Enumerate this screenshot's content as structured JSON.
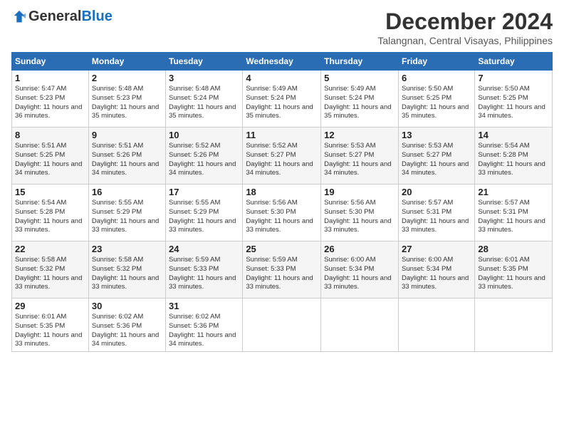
{
  "header": {
    "logo_general": "General",
    "logo_blue": "Blue",
    "month_title": "December 2024",
    "location": "Talangnan, Central Visayas, Philippines"
  },
  "weekdays": [
    "Sunday",
    "Monday",
    "Tuesday",
    "Wednesday",
    "Thursday",
    "Friday",
    "Saturday"
  ],
  "weeks": [
    [
      {
        "day": "1",
        "sunrise": "5:47 AM",
        "sunset": "5:23 PM",
        "daylight": "11 hours and 36 minutes."
      },
      {
        "day": "2",
        "sunrise": "5:48 AM",
        "sunset": "5:23 PM",
        "daylight": "11 hours and 35 minutes."
      },
      {
        "day": "3",
        "sunrise": "5:48 AM",
        "sunset": "5:24 PM",
        "daylight": "11 hours and 35 minutes."
      },
      {
        "day": "4",
        "sunrise": "5:49 AM",
        "sunset": "5:24 PM",
        "daylight": "11 hours and 35 minutes."
      },
      {
        "day": "5",
        "sunrise": "5:49 AM",
        "sunset": "5:24 PM",
        "daylight": "11 hours and 35 minutes."
      },
      {
        "day": "6",
        "sunrise": "5:50 AM",
        "sunset": "5:25 PM",
        "daylight": "11 hours and 35 minutes."
      },
      {
        "day": "7",
        "sunrise": "5:50 AM",
        "sunset": "5:25 PM",
        "daylight": "11 hours and 34 minutes."
      }
    ],
    [
      {
        "day": "8",
        "sunrise": "5:51 AM",
        "sunset": "5:25 PM",
        "daylight": "11 hours and 34 minutes."
      },
      {
        "day": "9",
        "sunrise": "5:51 AM",
        "sunset": "5:26 PM",
        "daylight": "11 hours and 34 minutes."
      },
      {
        "day": "10",
        "sunrise": "5:52 AM",
        "sunset": "5:26 PM",
        "daylight": "11 hours and 34 minutes."
      },
      {
        "day": "11",
        "sunrise": "5:52 AM",
        "sunset": "5:27 PM",
        "daylight": "11 hours and 34 minutes."
      },
      {
        "day": "12",
        "sunrise": "5:53 AM",
        "sunset": "5:27 PM",
        "daylight": "11 hours and 34 minutes."
      },
      {
        "day": "13",
        "sunrise": "5:53 AM",
        "sunset": "5:27 PM",
        "daylight": "11 hours and 34 minutes."
      },
      {
        "day": "14",
        "sunrise": "5:54 AM",
        "sunset": "5:28 PM",
        "daylight": "11 hours and 33 minutes."
      }
    ],
    [
      {
        "day": "15",
        "sunrise": "5:54 AM",
        "sunset": "5:28 PM",
        "daylight": "11 hours and 33 minutes."
      },
      {
        "day": "16",
        "sunrise": "5:55 AM",
        "sunset": "5:29 PM",
        "daylight": "11 hours and 33 minutes."
      },
      {
        "day": "17",
        "sunrise": "5:55 AM",
        "sunset": "5:29 PM",
        "daylight": "11 hours and 33 minutes."
      },
      {
        "day": "18",
        "sunrise": "5:56 AM",
        "sunset": "5:30 PM",
        "daylight": "11 hours and 33 minutes."
      },
      {
        "day": "19",
        "sunrise": "5:56 AM",
        "sunset": "5:30 PM",
        "daylight": "11 hours and 33 minutes."
      },
      {
        "day": "20",
        "sunrise": "5:57 AM",
        "sunset": "5:31 PM",
        "daylight": "11 hours and 33 minutes."
      },
      {
        "day": "21",
        "sunrise": "5:57 AM",
        "sunset": "5:31 PM",
        "daylight": "11 hours and 33 minutes."
      }
    ],
    [
      {
        "day": "22",
        "sunrise": "5:58 AM",
        "sunset": "5:32 PM",
        "daylight": "11 hours and 33 minutes."
      },
      {
        "day": "23",
        "sunrise": "5:58 AM",
        "sunset": "5:32 PM",
        "daylight": "11 hours and 33 minutes."
      },
      {
        "day": "24",
        "sunrise": "5:59 AM",
        "sunset": "5:33 PM",
        "daylight": "11 hours and 33 minutes."
      },
      {
        "day": "25",
        "sunrise": "5:59 AM",
        "sunset": "5:33 PM",
        "daylight": "11 hours and 33 minutes."
      },
      {
        "day": "26",
        "sunrise": "6:00 AM",
        "sunset": "5:34 PM",
        "daylight": "11 hours and 33 minutes."
      },
      {
        "day": "27",
        "sunrise": "6:00 AM",
        "sunset": "5:34 PM",
        "daylight": "11 hours and 33 minutes."
      },
      {
        "day": "28",
        "sunrise": "6:01 AM",
        "sunset": "5:35 PM",
        "daylight": "11 hours and 33 minutes."
      }
    ],
    [
      {
        "day": "29",
        "sunrise": "6:01 AM",
        "sunset": "5:35 PM",
        "daylight": "11 hours and 33 minutes."
      },
      {
        "day": "30",
        "sunrise": "6:02 AM",
        "sunset": "5:36 PM",
        "daylight": "11 hours and 34 minutes."
      },
      {
        "day": "31",
        "sunrise": "6:02 AM",
        "sunset": "5:36 PM",
        "daylight": "11 hours and 34 minutes."
      },
      null,
      null,
      null,
      null
    ]
  ]
}
